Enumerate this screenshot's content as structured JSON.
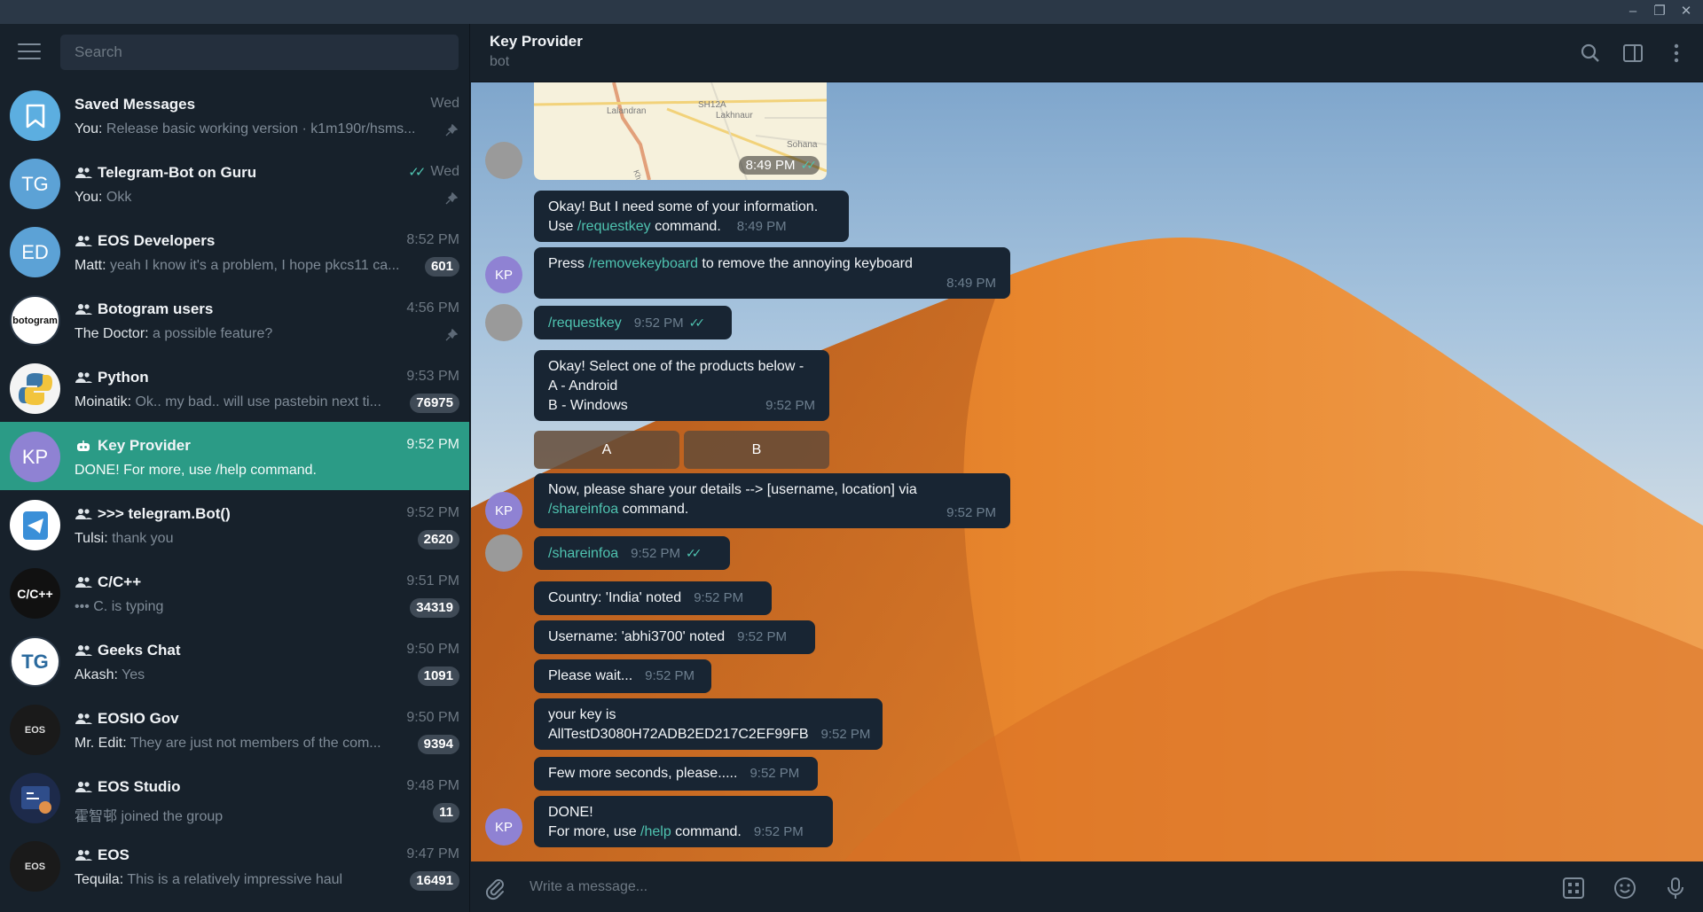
{
  "window": {
    "minimize": "–",
    "restore": "❐",
    "close": "✕"
  },
  "search": {
    "placeholder": "Search"
  },
  "chats": [
    {
      "name": "Saved Messages",
      "time": "Wed",
      "who": "You:",
      "preview": "Release basic working version · k1m190r/hsms...",
      "pinned": true,
      "group": false,
      "avatar_color": "#5caee0"
    },
    {
      "name": "Telegram-Bot on Guru",
      "time": "Wed",
      "who": "You:",
      "preview": "Okk",
      "pinned": true,
      "group": true,
      "initials": "TG",
      "avatar_color": "#5ca2d6",
      "read": true
    },
    {
      "name": "EOS Developers",
      "time": "8:52 PM",
      "who": "Matt:",
      "preview": "yeah I know it's a problem, I hope pkcs11 ca...",
      "badge": "601",
      "group": true,
      "initials": "ED",
      "avatar_color": "#5ca2d6"
    },
    {
      "name": "Botogram users",
      "time": "4:56 PM",
      "who": "The Doctor:",
      "preview": "a possible feature?",
      "pinned": true,
      "group": true,
      "avatar_text": "botogram",
      "avatar_color": "#ffffff"
    },
    {
      "name": "Python",
      "time": "9:53 PM",
      "who": "Moinatik:",
      "preview": "Ok.. my bad.. will use pastebin next ti...",
      "badge": "76975",
      "group": true,
      "avatar_color": "#f4f4f4"
    },
    {
      "name": "Key Provider",
      "time": "9:52 PM",
      "who": "",
      "preview": "DONE!  For more, use /help command.",
      "group": false,
      "bot": true,
      "initials": "KP",
      "avatar_color": "#8f82d3",
      "active": true
    },
    {
      "name": ">>> telegram.Bot()",
      "time": "9:52 PM",
      "who": "Tulsi:",
      "preview": "thank you",
      "badge": "2620",
      "group": true,
      "avatar_color": "#ffffff"
    },
    {
      "name": "C/C++",
      "time": "9:51 PM",
      "who": "",
      "preview": "••• C. is typing",
      "badge": "34319",
      "group": true,
      "avatar_text": "C/C++",
      "avatar_color": "#111111"
    },
    {
      "name": "Geeks Chat",
      "time": "9:50 PM",
      "who": "Akash:",
      "preview": "Yes",
      "badge": "1091",
      "group": true,
      "avatar_text": "TG",
      "avatar_color": "#ffffff"
    },
    {
      "name": "EOSIO Gov",
      "time": "9:50 PM",
      "who": "Mr. Edit:",
      "preview": "They are just not members of the com...",
      "badge": "9394",
      "group": true,
      "avatar_text": "EOS",
      "avatar_color": "#1a1a1a"
    },
    {
      "name": "EOS Studio",
      "time": "9:48 PM",
      "who": "",
      "preview": "霍智邨 joined the group",
      "badge": "11",
      "group": true,
      "avatar_color": "#1d2a4a"
    },
    {
      "name": "EOS",
      "time": "9:47 PM",
      "who": "Tequila:",
      "preview": "This is a relatively impressive haul",
      "badge": "16491",
      "group": true,
      "avatar_text": "EOS",
      "avatar_color": "#1a1a1a"
    }
  ],
  "header": {
    "title": "Key Provider",
    "subtitle": "bot"
  },
  "map": {
    "time": "8:49 PM",
    "labels": [
      "Lalandran",
      "SH12A",
      "Lakhnaur",
      "Sohana",
      "Kharar"
    ]
  },
  "messages": [
    {
      "id": "m1",
      "line1": "Okay! But I need some of your information.",
      "line2_pre": "Use ",
      "line2_cmd": "/requestkey",
      "line2_post": " command.",
      "time": "8:49 PM"
    },
    {
      "id": "m2",
      "pre": "Press ",
      "cmd": "/removekeyboard",
      "post": " to remove the annoying keyboard",
      "time": "8:49 PM"
    },
    {
      "id": "m3",
      "cmd": "/requestkey",
      "time": "9:52 PM"
    },
    {
      "id": "m4",
      "line1": "Okay! Select one of the products below -",
      "line2": "A - Android",
      "line3": "B - Windows",
      "time": "9:52 PM"
    },
    {
      "id": "m5",
      "line1": "Now, please share your details --> [username, location] via",
      "cmd": "/shareinfoa",
      "post": " command.",
      "time": "9:52 PM"
    },
    {
      "id": "m6",
      "cmd": "/shareinfoa",
      "time": "9:52 PM"
    },
    {
      "id": "m7",
      "text": "Country: 'India' noted",
      "time": "9:52 PM"
    },
    {
      "id": "m8",
      "text": "Username: 'abhi3700' noted",
      "time": "9:52 PM"
    },
    {
      "id": "m9",
      "text": "Please wait...",
      "time": "9:52 PM"
    },
    {
      "id": "m10",
      "line1": "your key is",
      "line2": "AllTestD3080H72ADB2ED217C2EF99FB",
      "time": "9:52 PM"
    },
    {
      "id": "m11",
      "text": "Few more seconds, please.....",
      "time": "9:52 PM"
    },
    {
      "id": "m12",
      "line1": "DONE!",
      "line2_pre": "For more, use ",
      "cmd": "/help",
      "post": " command.",
      "time": "9:52 PM"
    }
  ],
  "keyboard": {
    "a": "A",
    "b": "B"
  },
  "avatar_initials": "KP",
  "compose": {
    "placeholder": "Write a message..."
  },
  "colors": {
    "accent": "#2b9b86",
    "link": "#4fc3b0",
    "bubble": "#182533",
    "sidebar": "#17212b"
  }
}
